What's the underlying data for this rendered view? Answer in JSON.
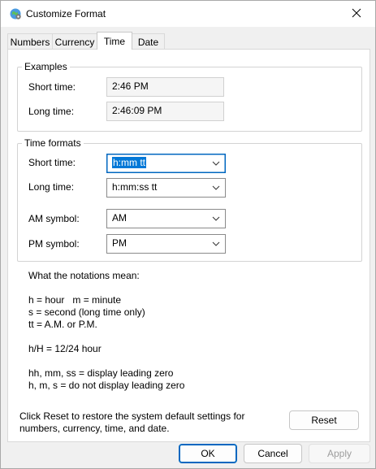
{
  "window": {
    "title": "Customize Format"
  },
  "tabs": [
    {
      "label": "Numbers"
    },
    {
      "label": "Currency"
    },
    {
      "label": "Time"
    },
    {
      "label": "Date"
    }
  ],
  "examples": {
    "group_label": "Examples",
    "short_time_label": "Short time:",
    "short_time_value": "2:46 PM",
    "long_time_label": "Long time:",
    "long_time_value": "2:46:09 PM"
  },
  "time_formats": {
    "group_label": "Time formats",
    "short_time_label": "Short time:",
    "short_time_value": "h:mm tt",
    "long_time_label": "Long time:",
    "long_time_value": "h:mm:ss tt",
    "am_label": "AM symbol:",
    "am_value": "AM",
    "pm_label": "PM symbol:",
    "pm_value": "PM"
  },
  "notations": {
    "heading": "What the notations mean:",
    "line1": "h = hour   m = minute",
    "line2": "s = second (long time only)",
    "line3": "tt = A.M. or P.M.",
    "line4": "h/H = 12/24 hour",
    "line5": "hh, mm, ss = display leading zero",
    "line6": "h, m, s = do not display leading zero"
  },
  "reset": {
    "text_line1": "Click Reset to restore the system default settings for",
    "text_line2": "numbers, currency, time, and date.",
    "button_label": "Reset"
  },
  "footer": {
    "ok_label": "OK",
    "cancel_label": "Cancel",
    "apply_label": "Apply"
  },
  "colors": {
    "accent": "#0067c0",
    "selection": "#0078d7"
  },
  "icons": {
    "title": "globe-settings-icon",
    "close": "close-icon",
    "dropdown": "chevron-down-icon"
  }
}
